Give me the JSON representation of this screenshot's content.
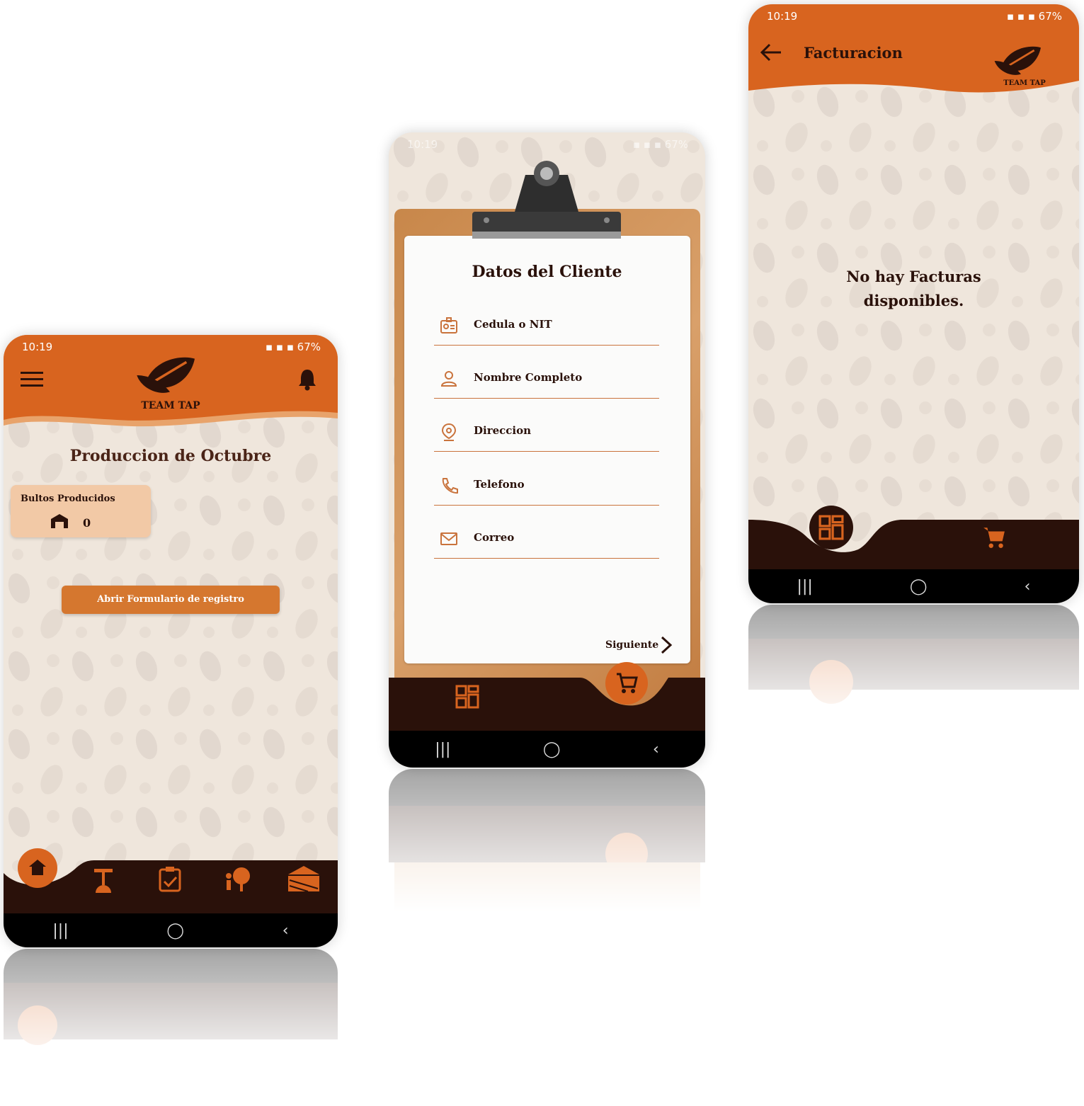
{
  "status": {
    "time": "10:19",
    "battery": "67%"
  },
  "phone1": {
    "brand": "TEAM TAP",
    "title": "Produccion de Octubre",
    "card_title": "Bultos Producidos",
    "card_value": "0",
    "button_label": "Abrir Formulario de registro",
    "nav_icons": [
      "home-icon",
      "scale-icon",
      "clipboard-check-icon",
      "tree-person-icon",
      "farm-icon"
    ]
  },
  "phone2": {
    "title": "Datos del Cliente",
    "fields": [
      {
        "label": "Cedula o NIT",
        "icon": "id-card-icon"
      },
      {
        "label": "Nombre Completo",
        "icon": "person-icon"
      },
      {
        "label": "Direccion",
        "icon": "location-icon"
      },
      {
        "label": "Telefono",
        "icon": "phone-icon"
      },
      {
        "label": "Correo",
        "icon": "mail-icon"
      }
    ],
    "next_label": "Siguiente"
  },
  "phone3": {
    "title": "Facturacion",
    "brand": "TEAM TAP",
    "empty_message_line1": "No hay Facturas",
    "empty_message_line2": "disponibles."
  },
  "colors": {
    "orange": "#d8641f",
    "dark_brown": "#2a110a",
    "light_orange": "#e8a36b",
    "bg": "#efe6dc"
  }
}
